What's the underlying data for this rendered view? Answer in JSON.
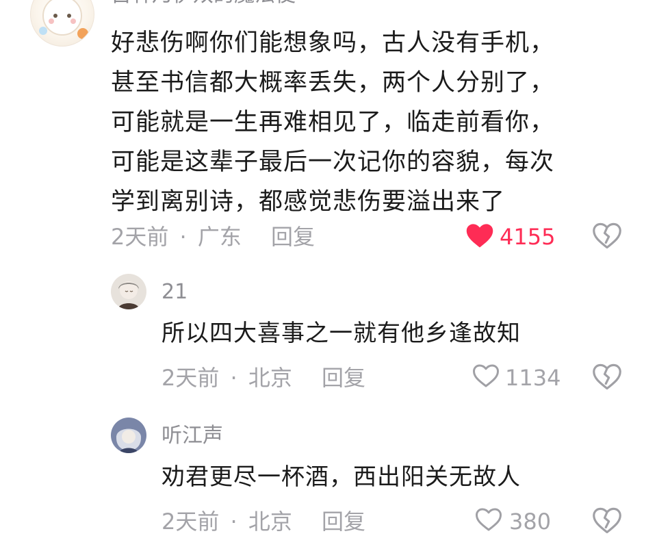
{
  "main_comment": {
    "author": "古林乃伊双的魔法使",
    "text": "好悲伤啊你们能想象吗，古人没有手机，\n甚至书信都大概率丢失，两个人分别了，\n可能就是一生再难相见了，临走前看你，\n可能是这辈子最后一次记你的容貌，每次\n学到离别诗，都感觉悲伤要溢出来了",
    "time": "2天前",
    "location": "广东",
    "reply_label": "回复",
    "likes": "4155",
    "liked": true,
    "like_color": "#fe2c55"
  },
  "replies": [
    {
      "author": "21",
      "text": "所以四大喜事之一就有他乡逢故知",
      "time": "2天前",
      "location": "北京",
      "reply_label": "回复",
      "likes": "1134"
    },
    {
      "author": "听江声",
      "text": "劝君更尽一杯酒，西出阳关无故人",
      "time": "2天前",
      "location": "北京",
      "reply_label": "回复",
      "likes": "380"
    }
  ],
  "separator": "·",
  "icons": {
    "like_filled": "heart-filled-icon",
    "like_outline": "heart-outline-icon",
    "dislike": "broken-heart-icon"
  }
}
